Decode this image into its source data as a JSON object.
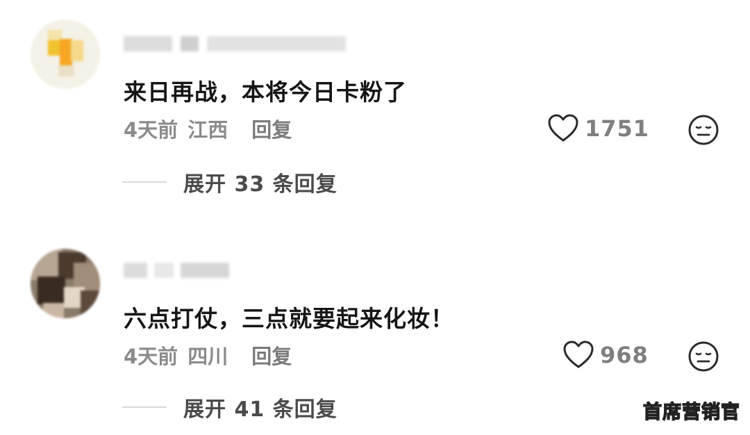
{
  "comments": [
    {
      "text": "来日再战，本将今日卡粉了",
      "time": "4天前",
      "region": "江西",
      "reply_label": "回复",
      "likes": "1751",
      "expand_label": "展开 33 条回复"
    },
    {
      "text": "六点打仗，三点就要起来化妆！",
      "time": "4天前",
      "region": "四川",
      "reply_label": "回复",
      "likes": "968",
      "expand_label": "展开 41 条回复"
    }
  ],
  "icons": {
    "like": "heart-outline-icon",
    "dislike": "neutral-face-icon"
  },
  "colors": {
    "text_primary": "#161616",
    "text_secondary": "#8b8b8b",
    "background": "#ffffff"
  },
  "watermark": "首席营销官"
}
